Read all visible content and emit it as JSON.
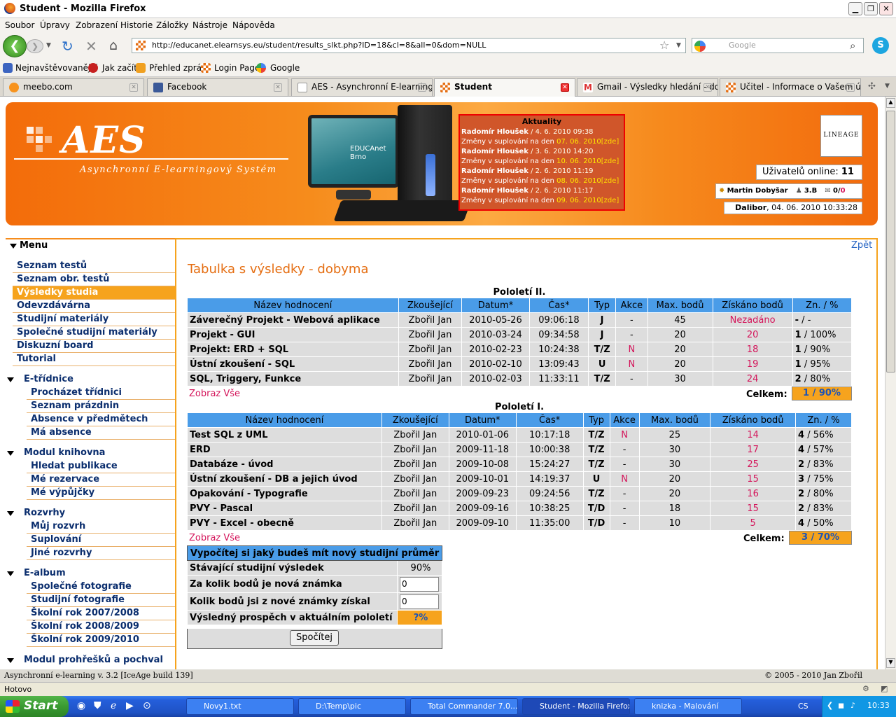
{
  "window": {
    "title": "Student - Mozilla Firefox"
  },
  "menubar": [
    "Soubor",
    "Úpravy",
    "Zobrazení",
    "Historie",
    "Záložky",
    "Nástroje",
    "Nápověda"
  ],
  "nav": {
    "url": "http://educanet.elearnsys.eu/student/results_slkt.php?ID=18&cl=8&all=0&dom=NULL",
    "search_placeholder": "Google"
  },
  "bookmarks": [
    "Nejnavštěvovanější",
    "Jak začít",
    "Přehled zpráv",
    "Login Page",
    "Google"
  ],
  "tabs": [
    "meebo.com",
    "Facebook",
    "AES - Asynchronní E-learning...",
    "Student",
    "Gmail - Výsledky hledání - dob...",
    "Učitel - Informace o Vašem účtu"
  ],
  "banner": {
    "logo": "AES",
    "subtitle": "Asynchronní E-learningový Systém",
    "monitor_brand": "EDUCAnet Brno",
    "lineage": "LINEAGE"
  },
  "news": {
    "header": "Aktuality",
    "items": [
      {
        "author": "Radomír Hloušek",
        "date": "/ 4. 6. 2010 09:38",
        "text": "Změny v suplování na den ",
        "day": "07. 06. 2010",
        "link": "[zde]"
      },
      {
        "author": "Radomír Hloušek",
        "date": "/ 3. 6. 2010 14:20",
        "text": "Změny v suplování na den ",
        "day": "10. 06. 2010",
        "link": "[zde]"
      },
      {
        "author": "Radomír Hloušek",
        "date": "/ 2. 6. 2010 11:19",
        "text": "Změny v suplování na den ",
        "day": "08. 06. 2010",
        "link": "[zde]"
      },
      {
        "author": "Radomír Hloušek",
        "date": "/ 2. 6. 2010 11:17",
        "text": "Změny v suplování na den ",
        "day": "09. 06. 2010",
        "link": "[zde]"
      }
    ]
  },
  "user": {
    "online_label": "Uživatelů online:",
    "online_count": "11",
    "name": "Martin Dobyšar",
    "class": "3.B",
    "messages": "0/",
    "messages_new": "0",
    "clock_user": "Dalibor",
    "clock_time": ", 04. 06. 2010 10:33:28"
  },
  "sidebar": {
    "header": "Menu",
    "items": [
      "Seznam testů",
      "Seznam obr. testů",
      "Výsledky studia",
      "Odevzdávárna",
      "Studijní materiály",
      "Společné studijní materiály",
      "Diskuzní board",
      "Tutorial"
    ],
    "groups": [
      {
        "title": "E-třídnice",
        "items": [
          "Procházet třídnici",
          "Seznam prázdnin",
          "Absence v předmětech",
          "Má absence"
        ]
      },
      {
        "title": "Modul knihovna",
        "items": [
          "Hledat publikace",
          "Mé rezervace",
          "Mé výpůjčky"
        ]
      },
      {
        "title": "Rozvrhy",
        "items": [
          "Můj rozvrh",
          "Suplování",
          "Jiné rozvrhy"
        ]
      },
      {
        "title": "E-album",
        "items": [
          "Společné fotografie",
          "Studijní fotografie",
          "Školní rok 2007/2008",
          "Školní rok 2008/2009",
          "Školní rok 2009/2010"
        ]
      },
      {
        "title": "Modul prohřešků a pochval",
        "items": []
      }
    ]
  },
  "main": {
    "back": "Zpět",
    "title": "Tabulka s výsledky - dobyma",
    "columns": [
      "Název hodnocení",
      "Zkoušející",
      "Datum*",
      "Čas*",
      "Typ",
      "Akce",
      "Max. bodů",
      "Získáno bodů",
      "Zn. / %"
    ],
    "show_all": "Zobraz Vše",
    "total_label": "Celkem:",
    "sem2": {
      "title": "Pololetí II.",
      "total": "1 / 90%",
      "rows": [
        [
          "Záverečný Projekt - Webová aplikace",
          "Zbořil Jan",
          "2010-05-26",
          "09:06:18",
          "J",
          "-",
          "45",
          "Nezadáno",
          "- / -"
        ],
        [
          "Projekt - GUI",
          "Zbořil Jan",
          "2010-03-24",
          "09:34:58",
          "J",
          "-",
          "20",
          "20",
          "1 / 100%"
        ],
        [
          "Projekt: ERD + SQL",
          "Zbořil Jan",
          "2010-02-23",
          "10:24:38",
          "T/Z",
          "N",
          "20",
          "18",
          "1 / 90%"
        ],
        [
          "Ústní zkoušení - SQL",
          "Zbořil Jan",
          "2010-02-10",
          "13:09:43",
          "U",
          "N",
          "20",
          "19",
          "1 / 95%"
        ],
        [
          "SQL, Triggery, Funkce",
          "Zbořil Jan",
          "2010-02-03",
          "11:33:11",
          "T/Z",
          "-",
          "30",
          "24",
          "2 / 80%"
        ]
      ]
    },
    "sem1": {
      "title": "Pololetí I.",
      "total": "3 / 70%",
      "rows": [
        [
          "Test SQL z UML",
          "Zbořil Jan",
          "2010-01-06",
          "10:17:18",
          "T/Z",
          "N",
          "25",
          "14",
          "4 / 56%"
        ],
        [
          "ERD",
          "Zbořil Jan",
          "2009-11-18",
          "10:00:38",
          "T/Z",
          "-",
          "30",
          "17",
          "4 / 57%"
        ],
        [
          "Databáze - úvod",
          "Zbořil Jan",
          "2009-10-08",
          "15:24:27",
          "T/Z",
          "-",
          "30",
          "25",
          "2 / 83%"
        ],
        [
          "Ústní zkoušení - DB a jejich úvod",
          "Zbořil Jan",
          "2009-10-01",
          "14:19:37",
          "U",
          "N",
          "20",
          "15",
          "3 / 75%"
        ],
        [
          "Opakování - Typografie",
          "Zbořil Jan",
          "2009-09-23",
          "09:24:56",
          "T/Z",
          "-",
          "20",
          "16",
          "2 / 80%"
        ],
        [
          "PVY - Pascal",
          "Zbořil Jan",
          "2009-09-16",
          "10:38:25",
          "T/D",
          "-",
          "18",
          "15",
          "2 / 83%"
        ],
        [
          "PVY - Excel - obecně",
          "Zbořil Jan",
          "2009-09-10",
          "11:35:00",
          "T/D",
          "-",
          "10",
          "5",
          "4 / 50%"
        ]
      ]
    },
    "calc": {
      "title": "Vypočítej si jaký budeš mít nový studijní průměr",
      "rows": [
        "Stávající studijní výsledek",
        "Za kolik bodů je nová známka",
        "Kolik bodů jsi z nové známky získal",
        "Výsledný prospěch v aktuálním pololetí"
      ],
      "current": "90%",
      "input1": "0",
      "input2": "0",
      "result": "?%",
      "button": "Spočítej"
    }
  },
  "footer": {
    "left": "Asynchronní e-learning  v. 3.2 [IceAge build 139]",
    "right": "© 2005 - 2010  Jan Zbořil"
  },
  "status": "Hotovo",
  "taskbar": {
    "start": "Start",
    "tasks": [
      "Novy1.txt",
      "D:\\Temp\\pic",
      "Total Commander 7.0...",
      "Student - Mozilla Firefox",
      "knizka - Malování"
    ],
    "lang": "CS",
    "time": "10:33"
  },
  "colors": {
    "orange": "#f68c1c",
    "header_blue": "#4a9ce8",
    "menu_sel": "#f6a31d",
    "accent_red": "#d4145a"
  }
}
